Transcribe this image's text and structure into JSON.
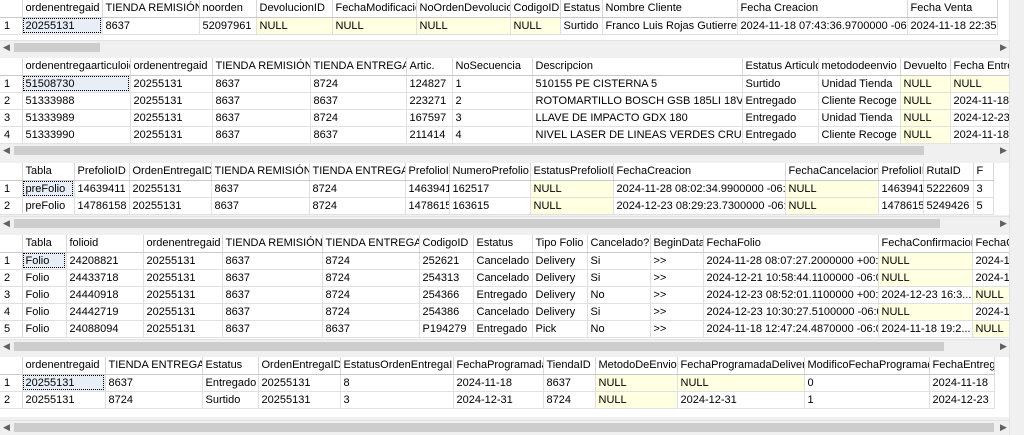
{
  "grids": [
    {
      "columns": [
        "",
        "ordenentregaid",
        "TIENDA REMISIÓN",
        "noorden",
        "DevolucionID",
        "FechaModificacion",
        "NoOrdenDevolucion",
        "CodigoID",
        "Estatus",
        "Nombre Cliente",
        "Fecha Creacion",
        "Fecha Venta"
      ],
      "rows": [
        [
          "1",
          "20255131",
          "8637",
          "52097961",
          "NULL",
          "NULL",
          "NULL",
          "NULL",
          "Surtido",
          "Franco Luis Rojas Gutierrez",
          "2024-11-18 07:43:36.9700000 -06:00",
          "2024-11-18 22:35:5"
        ]
      ]
    },
    {
      "columns": [
        "",
        "ordenentregaarticuloid",
        "ordenentregaid",
        "TIENDA REMISIÓN",
        "TIENDA ENTREGA",
        "Artic.",
        "NoSecuencia",
        "Descripcion",
        "Estatus Articulo",
        "metododeenvio",
        "Devuelto",
        "Fecha Entrega"
      ],
      "rows": [
        [
          "1",
          "51508730",
          "20255131",
          "8637",
          "8724",
          "124827",
          "1",
          "510155 PE CISTERNA 5",
          "Surtido",
          "Unidad Tienda",
          "NULL",
          "NULL"
        ],
        [
          "2",
          "51333988",
          "20255131",
          "8637",
          "8637",
          "223271",
          "2",
          "ROTOMARTILLO BOSCH GSB 185LI 18V 1",
          "Entregado",
          "Cliente Recoge",
          "NULL",
          "2024-11-18 1"
        ],
        [
          "3",
          "51333989",
          "20255131",
          "8637",
          "8724",
          "167597",
          "3",
          "LLAVE DE IMPACTO GDX 180",
          "Entregado",
          "Unidad Tienda",
          "NULL",
          "2024-12-23 1"
        ],
        [
          "4",
          "51333990",
          "20255131",
          "8637",
          "8637",
          "211414",
          "4",
          "NIVEL LASER DE LINEAS VERDES CRUZAD",
          "Entregado",
          "Cliente Recoge",
          "NULL",
          "2024-11-18 1"
        ]
      ]
    },
    {
      "columns": [
        "",
        "Tabla",
        "PrefolioID",
        "OrdenEntregaID",
        "TIENDA REMISIÓN",
        "TIENDA ENTREGA",
        "PrefolioID",
        "NumeroPrefolio",
        "EstatusPrefolioID",
        "FechaCreacion",
        "FechaCancelacion",
        "PrefolioID",
        "RutaID",
        "F"
      ],
      "rows": [
        [
          "1",
          "preFolio",
          "14639411",
          "20255131",
          "8637",
          "8724",
          "14639411",
          "162517",
          "NULL",
          "2024-11-28 08:02:34.9900000 -06:00",
          "NULL",
          "14639411",
          "5222609",
          "3"
        ],
        [
          "2",
          "preFolio",
          "14786158",
          "20255131",
          "8637",
          "8724",
          "14786158",
          "163615",
          "NULL",
          "2024-12-23 08:29:23.7300000 -06:00",
          "NULL",
          "14786158",
          "5249426",
          "5"
        ]
      ]
    },
    {
      "columns": [
        "",
        "Tabla",
        "folioid",
        "ordenentregaid",
        "TIENDA REMISIÓN",
        "TIENDA ENTREGA",
        "CodigoID",
        "Estatus",
        "Tipo Folio",
        "Cancelado?",
        "BeginData",
        "FechaFolio",
        "FechaConfirmacion",
        "FechaCance"
      ],
      "rows": [
        [
          "1",
          "Folio",
          "24208821",
          "20255131",
          "8637",
          "8724",
          "252621",
          "Cancelado",
          "Delivery",
          "Si",
          ">>",
          "2024-11-28 08:07:27.2000000 +00:00",
          "NULL",
          "2024-11-28"
        ],
        [
          "2",
          "Folio",
          "24433718",
          "20255131",
          "8637",
          "8724",
          "254313",
          "Cancelado",
          "Delivery",
          "Si",
          ">>",
          "2024-12-21 10:58:44.1100000 -06:00",
          "NULL",
          "2024-12-21"
        ],
        [
          "3",
          "Folio",
          "24440918",
          "20255131",
          "8637",
          "8724",
          "254366",
          "Entregado",
          "Delivery",
          "No",
          ">>",
          "2024-12-23 08:52:01.1100000 +00:00",
          "2024-12-23 16:3...",
          "NULL"
        ],
        [
          "4",
          "Folio",
          "24442719",
          "20255131",
          "8637",
          "8724",
          "254386",
          "Cancelado",
          "Delivery",
          "Si",
          ">>",
          "2024-12-23 10:30:27.5100000 -06:00",
          "NULL",
          "2024-12-27"
        ],
        [
          "5",
          "Folio",
          "24088094",
          "20255131",
          "8637",
          "8637",
          "P194279",
          "Entregado",
          "Pick",
          "No",
          ">>",
          "2024-11-18 12:47:24.4870000 -06:00",
          "2024-11-18 19:2...",
          "NULL"
        ]
      ]
    },
    {
      "columns": [
        "",
        "ordenentregaid",
        "TIENDA ENTREGA",
        "Estatus",
        "OrdenEntregaID",
        "EstatusOrdenEntregaID",
        "FechaProgramada",
        "TiendaID",
        "MetodoDeEnvio",
        "FechaProgramadaDelivery",
        "ModificoFechaProgramada",
        "FechaEntrega"
      ],
      "rows": [
        [
          "1",
          "20255131",
          "8637",
          "Entregado",
          "20255131",
          "8",
          "2024-11-18",
          "8637",
          "NULL",
          "NULL",
          "0",
          "2024-11-18"
        ],
        [
          "2",
          "20255131",
          "8724",
          "Surtido",
          "20255131",
          "3",
          "2024-12-31",
          "8724",
          "NULL",
          "2024-12-31",
          "1",
          "2024-12-23"
        ]
      ]
    }
  ],
  "scroll_arrows": {
    "left": "◀",
    "right": "▶"
  }
}
